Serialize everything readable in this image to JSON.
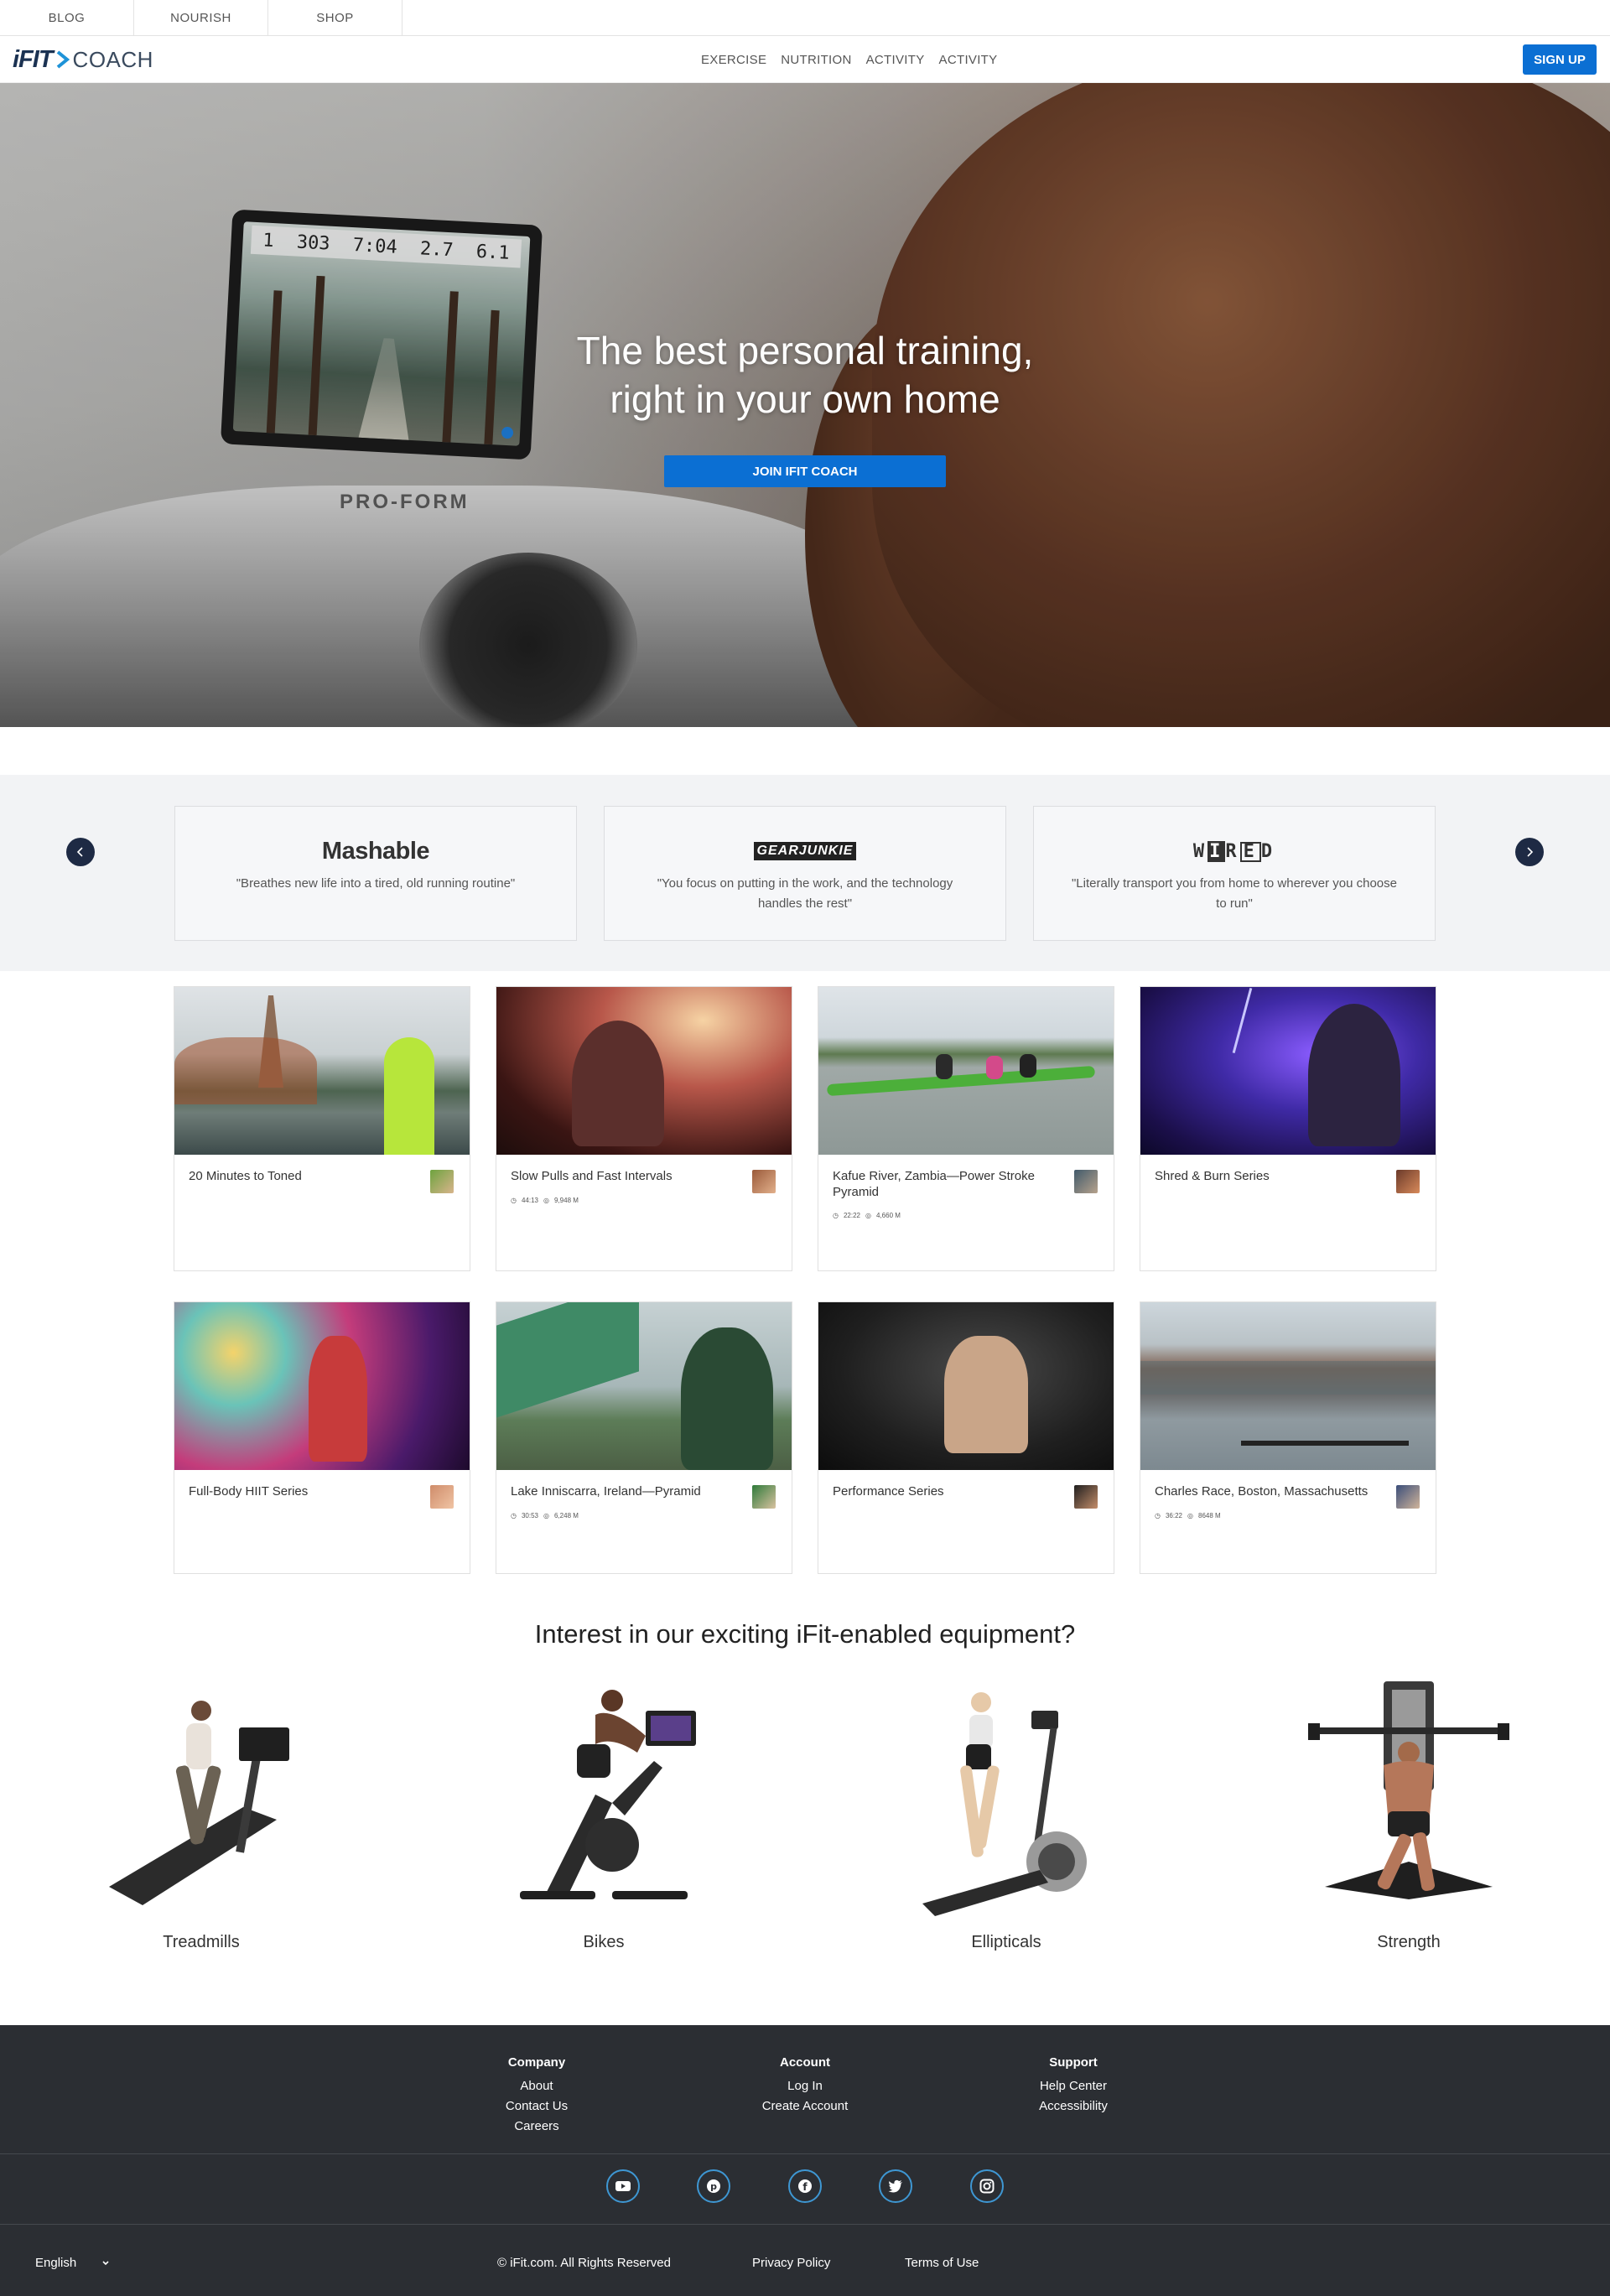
{
  "utility_nav": [
    "BLOG",
    "NOURISH",
    "SHOP"
  ],
  "brand": {
    "logo_ifit": "iFIT",
    "logo_coach": "COACH"
  },
  "main_nav": [
    "EXERCISE",
    "NUTRITION",
    "ACTIVITY",
    "ACTIVITY"
  ],
  "signup_label": "SIGN UP",
  "hero": {
    "title_line1": "The best personal training,",
    "title_line2": "right in your own home",
    "cta": "JOIN IFIT COACH",
    "tablet_stats": [
      "1",
      "303",
      "7:04",
      "2.7",
      "6.1"
    ],
    "machine_brand": "PRO-FORM"
  },
  "press": [
    {
      "source": "Mashable",
      "quote": "\"Breathes new life into a tired, old running routine\""
    },
    {
      "source": "GEARJUNKIE",
      "quote": "\"You focus on putting in the work, and the technology handles the rest\""
    },
    {
      "source": "WIRED",
      "quote": "\"Literally transport you from home to wherever you choose to run\""
    }
  ],
  "workouts": [
    {
      "title": "20 Minutes to Toned",
      "time": "",
      "distance": ""
    },
    {
      "title": "Slow Pulls and Fast Intervals",
      "time": "44:13",
      "distance": "9,948 M"
    },
    {
      "title": "Kafue River, Zambia—Power Stroke Pyramid",
      "time": "22:22",
      "distance": "4,660 M"
    },
    {
      "title": "Shred & Burn Series",
      "time": "",
      "distance": ""
    },
    {
      "title": "Full-Body HIIT Series",
      "time": "",
      "distance": ""
    },
    {
      "title": "Lake Inniscarra, Ireland—Pyramid",
      "time": "30:53",
      "distance": "6,248 M"
    },
    {
      "title": "Performance Series",
      "time": "",
      "distance": ""
    },
    {
      "title": "Charles Race, Boston, Massachusetts",
      "time": "36:22",
      "distance": "8648 M"
    }
  ],
  "equipment_heading": "Interest in our exciting iFit-enabled equipment?",
  "equipment": [
    "Treadmills",
    "Bikes",
    "Ellipticals",
    "Strength"
  ],
  "footer": {
    "company": {
      "heading": "Company",
      "links": [
        "About",
        "Contact Us",
        "Careers"
      ]
    },
    "account": {
      "heading": "Account",
      "links": [
        "Log In",
        "Create Account"
      ]
    },
    "support": {
      "heading": "Support",
      "links": [
        "Help Center",
        "Accessibility"
      ]
    },
    "social_icons": [
      "youtube-icon",
      "pinterest-icon",
      "facebook-icon",
      "twitter-icon",
      "instagram-icon"
    ],
    "language": "English",
    "copyright": "© iFit.com. All Rights Reserved",
    "privacy": "Privacy Policy",
    "terms": "Terms of Use"
  },
  "colors": {
    "primary": "#0b6fd3",
    "navy": "#1e2a44",
    "footer_bg": "#2b2e33",
    "social_ring": "#3e97d3"
  }
}
